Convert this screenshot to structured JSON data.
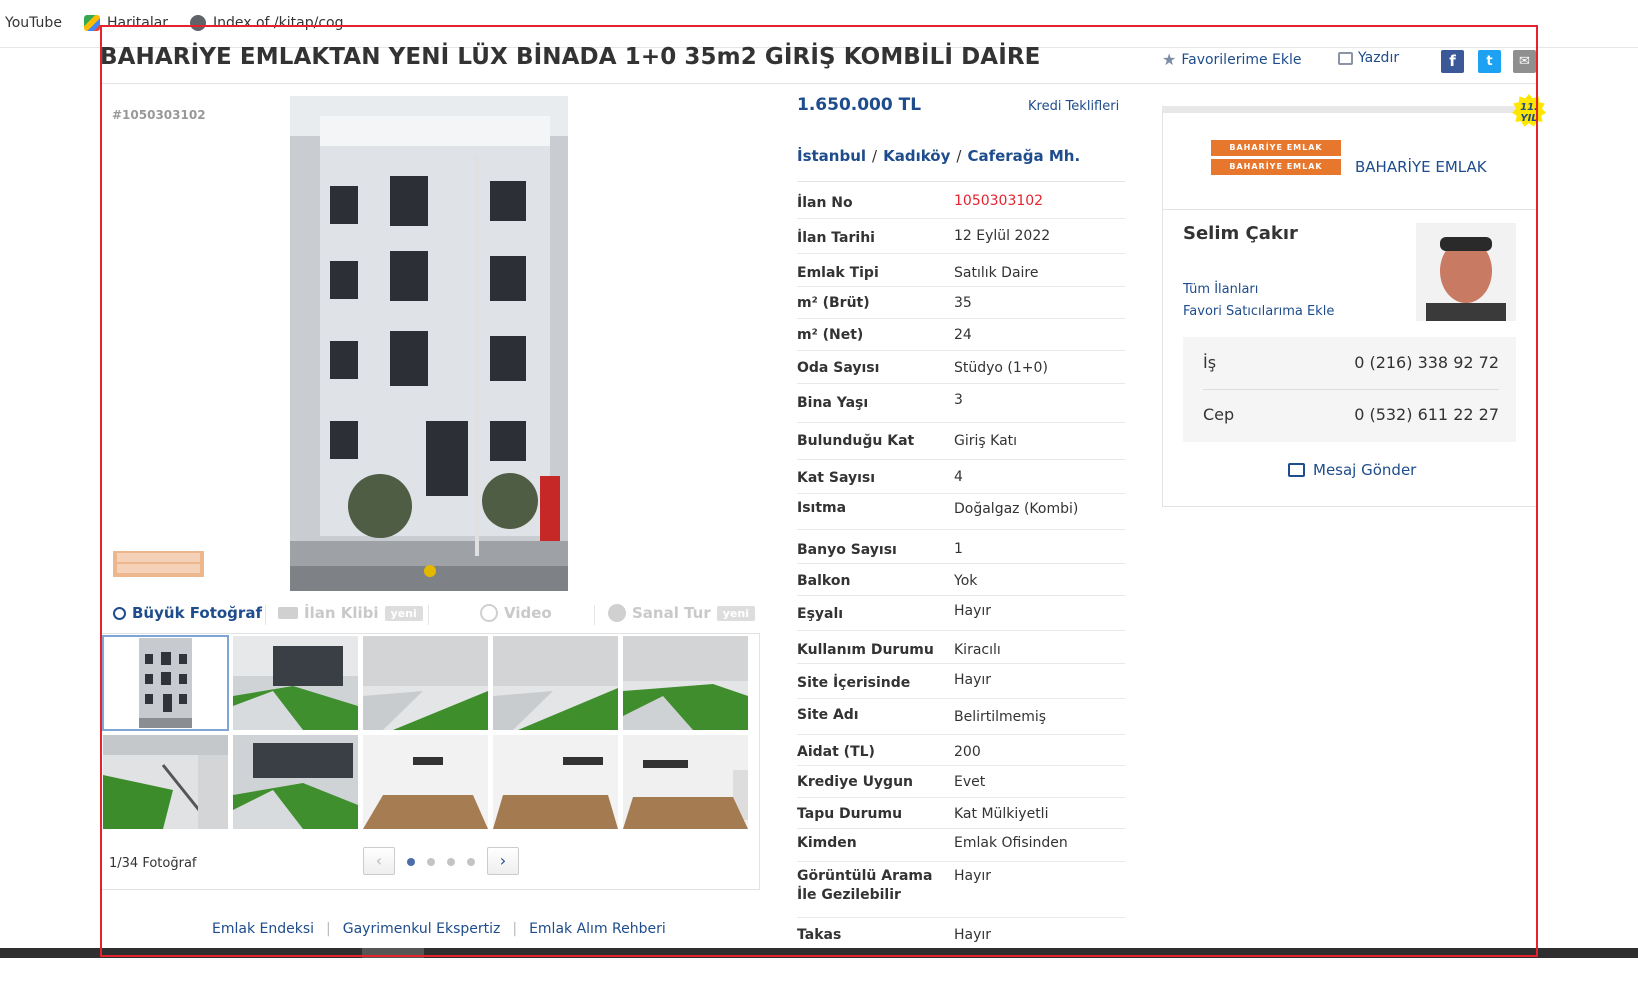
{
  "bookmarks": [
    {
      "label": "YouTube"
    },
    {
      "label": "Haritalar"
    },
    {
      "label": "Index of /kitap/cog..."
    }
  ],
  "listing": {
    "title": "BAHARİYE EMLAKTAN YENİ LÜX BİNADA 1+0 35m2 GİRİŞ KOMBİLİ DAİRE",
    "id_label": "#1050303102",
    "favorite_label": "Favorilerime Ekle",
    "print_label": "Yazdır",
    "price": "1.650.000 TL",
    "credit_label": "Kredi Teklifleri",
    "location": {
      "city": "İstanbul",
      "district": "Kadıköy",
      "neighborhood": "Caferağa Mh."
    }
  },
  "gallery": {
    "big_photo_label": "Büyük Fotoğraf",
    "clip_label": "İlan Klibi",
    "new_badge": "yeni",
    "video_label": "Video",
    "tour_label": "Sanal Tur",
    "photo_count": "1/34 Fotoğraf",
    "prev_icon": "‹",
    "next_icon": "›"
  },
  "details": [
    {
      "key": "İlan No",
      "value": "1050303102"
    },
    {
      "key": "İlan Tarihi",
      "value": "12 Eylül 2022"
    },
    {
      "key": "Emlak Tipi",
      "value": "Satılık Daire"
    },
    {
      "key": "m² (Brüt)",
      "value": "35"
    },
    {
      "key": "m² (Net)",
      "value": "24"
    },
    {
      "key": "Oda Sayısı",
      "value": "Stüdyo (1+0)"
    },
    {
      "key": "Bina Yaşı",
      "value": "3"
    },
    {
      "key": "Bulunduğu Kat",
      "value": "Giriş Katı"
    },
    {
      "key": "Kat Sayısı",
      "value": "4"
    },
    {
      "key": "Isıtma",
      "value": "Doğalgaz (Kombi)"
    },
    {
      "key": "Banyo Sayısı",
      "value": "1"
    },
    {
      "key": "Balkon",
      "value": "Yok"
    },
    {
      "key": "Eşyalı",
      "value": "Hayır"
    },
    {
      "key": "Kullanım Durumu",
      "value": "Kiracılı"
    },
    {
      "key": "Site İçerisinde",
      "value": "Hayır"
    },
    {
      "key": "Site Adı",
      "value": "Belirtilmemiş"
    },
    {
      "key": "Aidat (TL)",
      "value": "200"
    },
    {
      "key": "Krediye Uygun",
      "value": "Evet"
    },
    {
      "key": "Tapu Durumu",
      "value": "Kat Mülkiyetli"
    },
    {
      "key": "Kimden",
      "value": "Emlak Ofisinden"
    },
    {
      "key": "Görüntülü Arama İle Gezilebilir",
      "value": "Hayır"
    },
    {
      "key": "Takas",
      "value": "Hayır"
    }
  ],
  "seller": {
    "badge": "11. YIL",
    "store_name": "BAHARİYE EMLAK",
    "logo_text": "BAHARİYE EMLAK",
    "agent_name": "Selim Çakır",
    "all_listings": "Tüm İlanları",
    "add_favorite_seller": "Favori Satıcılarıma Ekle",
    "phones": [
      {
        "type": "İş",
        "number": "0 (216) 338 92 72"
      },
      {
        "type": "Cep",
        "number": "0 (532) 611 22 27"
      }
    ],
    "message_label": "Mesaj Gönder"
  },
  "footer": {
    "links": [
      "Emlak Endeksi",
      "Gayrimenkul Ekspertiz",
      "Emlak Alım Rehberi"
    ],
    "separator": "|"
  },
  "colors": {
    "link": "#1e4c8c",
    "id_red": "#e5232f",
    "frame_red": "#e5232f",
    "brand_orange": "#e8772e",
    "badge_yellow": "#ffe600"
  }
}
